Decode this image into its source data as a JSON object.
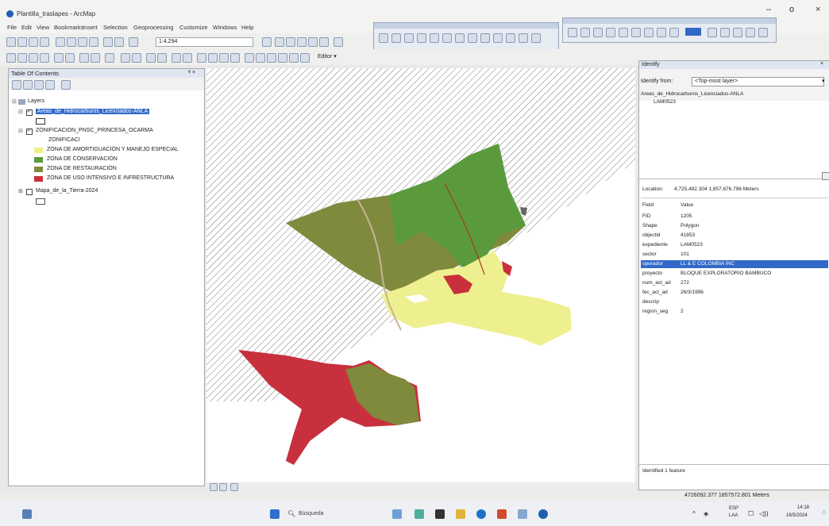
{
  "app": {
    "title": "Plantilla_traslapes - ArcMap",
    "win_min": "–",
    "win_max": "o",
    "win_close": "×"
  },
  "menu": [
    "File",
    "Edit",
    "View",
    "Bookmarks",
    "Insert",
    "Selection",
    "Geoprocessing",
    "Customize",
    "Windows",
    "Help"
  ],
  "toolbar": {
    "scale": "1:4.294",
    "editor_label": "Editor ▾"
  },
  "toc": {
    "title": "Table Of Contents",
    "close": "ᵠ ×",
    "root": "Layers",
    "layer1": "Areas_de_Hidrocarburos_Licenciados-ANLA",
    "layer2": "ZONIFICACION_PNSC_PRINCESA_OCARMA",
    "layer2_sub": "ZONIFICACI",
    "legend": [
      {
        "label": "ZONA DE AMORTIGUACIÓN Y MANEJO ESPECIAL",
        "color": "#eef08f"
      },
      {
        "label": "ZONA DE CONSERVACIÓN",
        "color": "#5b9a3c"
      },
      {
        "label": "ZONA DE RESTAURACIÓN",
        "color": "#7f8a3c"
      },
      {
        "label": "ZONA DE USO INTENSIVO E INFRESTRUCTURA",
        "color": "#c8303d"
      }
    ],
    "layer3": "Mapa_de_la_Tierra-2024"
  },
  "identify": {
    "title": "Identify",
    "from_label": "Identify from:",
    "from_value": "<Top-most layer>",
    "tree_root": "Areas_de_Hidrocarburos_Licenciados-ANLA",
    "tree_child": "LAM0523",
    "location_label": "Location:",
    "location_value": "4,725,492.304  1,857,676.796 Meters",
    "col_field": "Field",
    "col_value": "Value",
    "attributes": [
      {
        "field": "FID",
        "value": "1205"
      },
      {
        "field": "Shape",
        "value": "Polygon"
      },
      {
        "field": "objectid",
        "value": "41853"
      },
      {
        "field": "expediente",
        "value": "LAM0523"
      },
      {
        "field": "sector",
        "value": "101"
      },
      {
        "field": "operador",
        "value": "LL & E COLOMBIA INC"
      },
      {
        "field": "proyecto",
        "value": "BLOQUE EXPLORATORIO BAMBUCO"
      },
      {
        "field": "num_act_ad",
        "value": "272"
      },
      {
        "field": "fec_act_ad",
        "value": "26/3/1996"
      },
      {
        "field": "descrip",
        "value": ""
      },
      {
        "field": "region_seg",
        "value": "2"
      }
    ],
    "footer": "Identified 1 feature"
  },
  "status": {
    "coords": "4726092.377  1857572.801 Meters"
  },
  "taskbar": {
    "search": "Búsqueda",
    "lang": "ESP",
    "lang2": "LAA",
    "time": "14:18",
    "date": "16/5/2024"
  },
  "colors": {
    "amortiguacion": "#eef08f",
    "conservacion": "#5b9a3c",
    "restauracion": "#7f8a3c",
    "uso_intensivo": "#c8303d",
    "selection": "#3269c8"
  }
}
